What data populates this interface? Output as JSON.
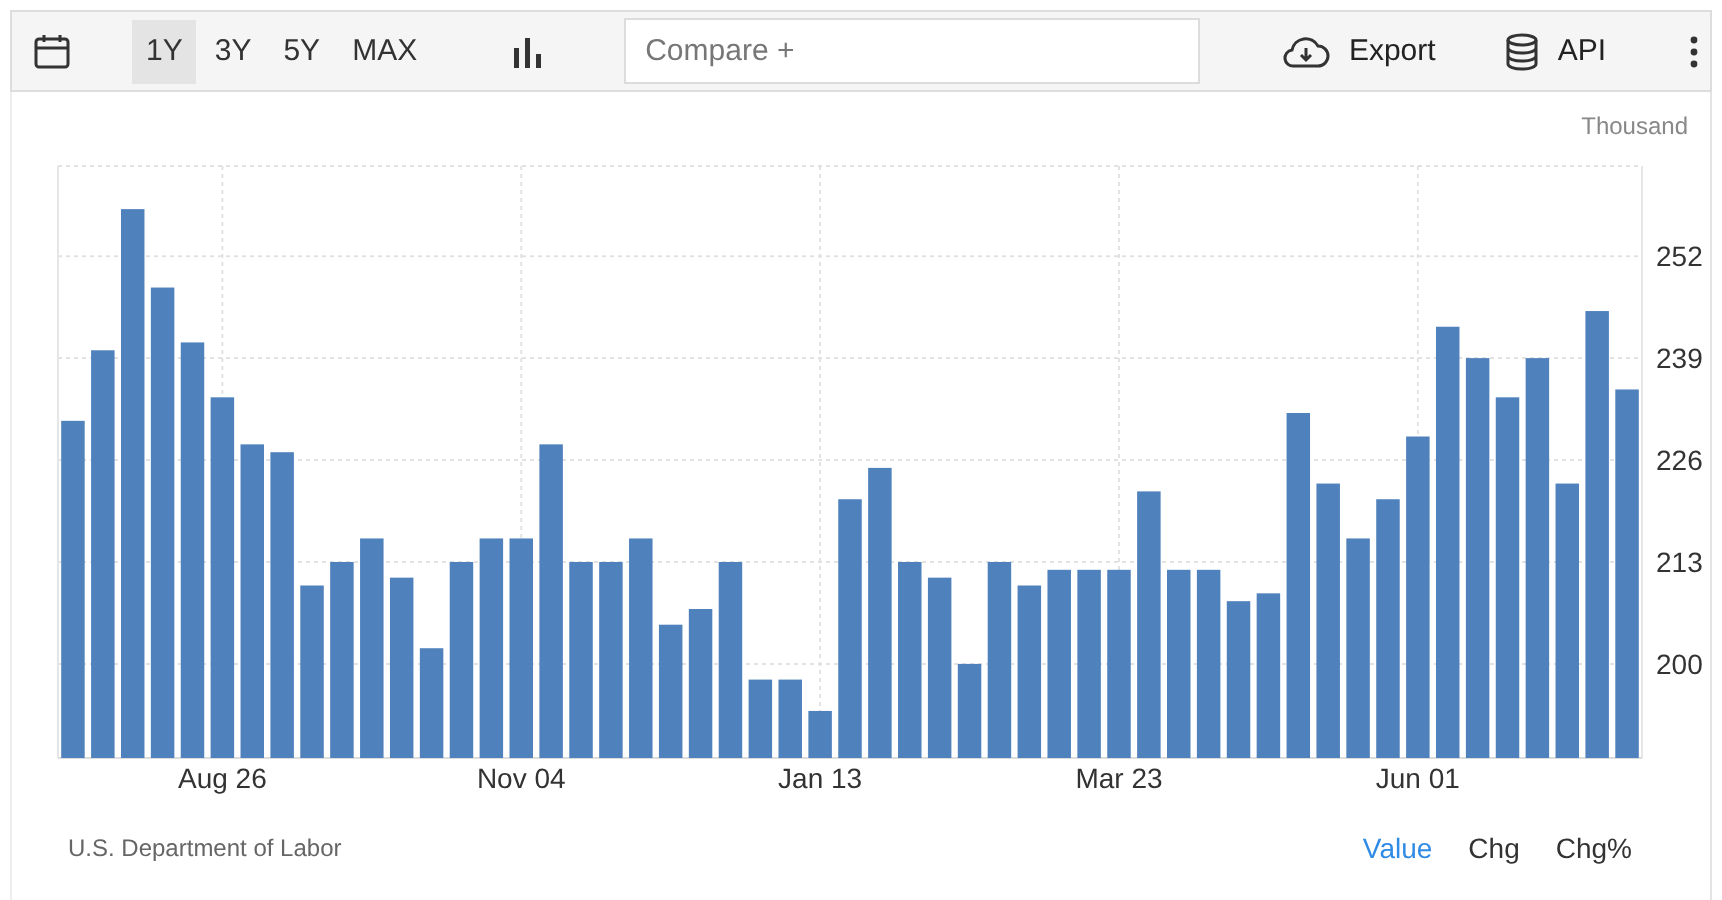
{
  "toolbar": {
    "ranges": [
      {
        "label": "1Y",
        "selected": true
      },
      {
        "label": "3Y",
        "selected": false
      },
      {
        "label": "5Y",
        "selected": false
      },
      {
        "label": "MAX",
        "selected": false
      }
    ],
    "compare": {
      "placeholder": "Compare +"
    },
    "export": "Export",
    "api": "API"
  },
  "chart": {
    "unit": "Thousand",
    "chart_data": {
      "type": "bar",
      "categories": [
        null,
        null,
        null,
        null,
        null,
        "Aug 26",
        null,
        null,
        null,
        null,
        null,
        null,
        null,
        null,
        null,
        "Nov 04",
        null,
        null,
        null,
        null,
        null,
        null,
        null,
        null,
        null,
        "Jan 13",
        null,
        null,
        null,
        null,
        null,
        null,
        null,
        null,
        null,
        "Mar 23",
        null,
        null,
        null,
        null,
        null,
        null,
        null,
        null,
        null,
        "Jun 01",
        null,
        null,
        null,
        null,
        null,
        null,
        null
      ],
      "series": [
        {
          "color": "#4f81bd",
          "values": [
            231,
            240,
            258,
            248,
            241,
            234,
            228,
            227,
            210,
            213,
            216,
            211,
            202,
            213,
            216,
            216,
            228,
            213,
            213,
            216,
            205,
            207,
            213,
            198,
            198,
            194,
            221,
            225,
            213,
            211,
            200,
            213,
            210,
            212,
            212,
            212,
            222,
            212,
            212,
            208,
            209,
            232,
            223,
            216,
            221,
            229,
            243,
            239,
            234,
            239,
            223,
            245,
            235
          ]
        }
      ],
      "grid": true,
      "ylim": [
        188,
        263.5
      ],
      "yticks": [
        200,
        213,
        226,
        239,
        252
      ]
    }
  },
  "footer": {
    "source": "U.S. Department of Labor",
    "modes": [
      {
        "label": "Value",
        "selected": true
      },
      {
        "label": "Chg",
        "selected": false
      },
      {
        "label": "Chg%",
        "selected": false
      }
    ]
  }
}
